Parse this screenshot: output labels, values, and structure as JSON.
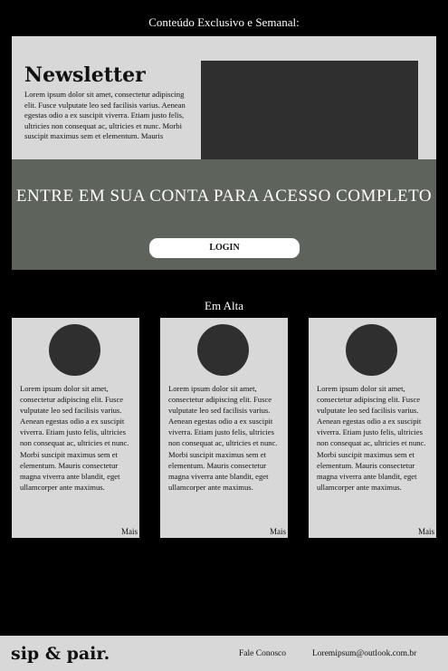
{
  "header": {
    "title": "Conteúdo Exclusivo e Semanal:"
  },
  "newsletter": {
    "title": "Newsletter",
    "body": "Lorem ipsum dolor sit amet, consectetur adipiscing elit. Fusce vulputate leo sed facilisis varius. Aenean egestas odio a ex suscipit viverra. Etiam justo felis, ultricies non consequat ac, ultricies et nunc. Morbi suscipit maximus sem et elementum. Mauris",
    "overlay_message": "ENTRE EM SUA CONTA PARA ACESSO COMPLETO",
    "login_label": "LOGIN"
  },
  "trending": {
    "title": "Em Alta",
    "cards": [
      {
        "text": "Lorem ipsum dolor sit amet, consectetur adipiscing elit. Fusce vulputate leo sed facilisis varius. Aenean egestas odio a ex suscipit viverra. Etiam justo felis, ultricies non consequat ac, ultricies et nunc. Morbi suscipit maximus sem et elementum. Mauris consectetur magna viverra ante blandit, eget ullamcorper ante maximus.",
        "more_label": "Mais"
      },
      {
        "text": "Lorem ipsum dolor sit amet, consectetur adipiscing elit. Fusce vulputate leo sed facilisis varius. Aenean egestas odio a ex suscipit viverra. Etiam justo felis, ultricies non consequat ac, ultricies et nunc. Morbi suscipit maximus sem et elementum. Mauris consectetur magna viverra ante blandit, eget ullamcorper ante maximus.",
        "more_label": "Mais"
      },
      {
        "text": "Lorem ipsum dolor sit amet, consectetur adipiscing elit. Fusce vulputate leo sed facilisis varius. Aenean egestas odio a ex suscipit viverra. Etiam justo felis, ultricies non consequat ac, ultricies et nunc. Morbi suscipit maximus sem et elementum. Mauris consectetur magna viverra ante blandit, eget ullamcorper ante maximus.",
        "more_label": "Mais"
      }
    ]
  },
  "footer": {
    "brand": "sip & pair.",
    "contact_label": "Fale Conosco",
    "email": "Loremipsum@outlook.com.br"
  },
  "colors": {
    "background": "#000000",
    "panel": "#d8d8d8",
    "placeholder": "#2f2f2f",
    "overlay": "#5e645c"
  }
}
